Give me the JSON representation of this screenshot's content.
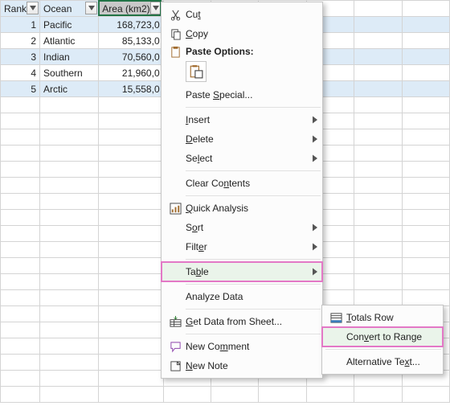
{
  "table": {
    "headers": {
      "rank": "Rank",
      "ocean": "Ocean",
      "area": "Area (km2)"
    },
    "rows": [
      {
        "rank": "1",
        "ocean": "Pacific",
        "area": "168,723,0"
      },
      {
        "rank": "2",
        "ocean": "Atlantic",
        "area": "85,133,0"
      },
      {
        "rank": "3",
        "ocean": "Indian",
        "area": "70,560,0"
      },
      {
        "rank": "4",
        "ocean": "Southern",
        "area": "21,960,0"
      },
      {
        "rank": "5",
        "ocean": "Arctic",
        "area": "15,558,0"
      }
    ]
  },
  "menu": {
    "cut": "Cut",
    "copy": "Copy",
    "paste_options_label": "Paste Options:",
    "paste_special": "Paste Special...",
    "insert": "Insert",
    "delete": "Delete",
    "select": "Select",
    "clear_contents": "Clear Contents",
    "quick_analysis": "Quick Analysis",
    "sort": "Sort",
    "filter": "Filter",
    "table": "Table",
    "analyze_data": "Analyze Data",
    "get_data": "Get Data from Sheet...",
    "new_comment": "New Comment",
    "new_note": "New Note"
  },
  "submenu": {
    "totals_row": "Totals Row",
    "convert_to_range": "Convert to Range",
    "alternative_text": "Alternative Text..."
  }
}
